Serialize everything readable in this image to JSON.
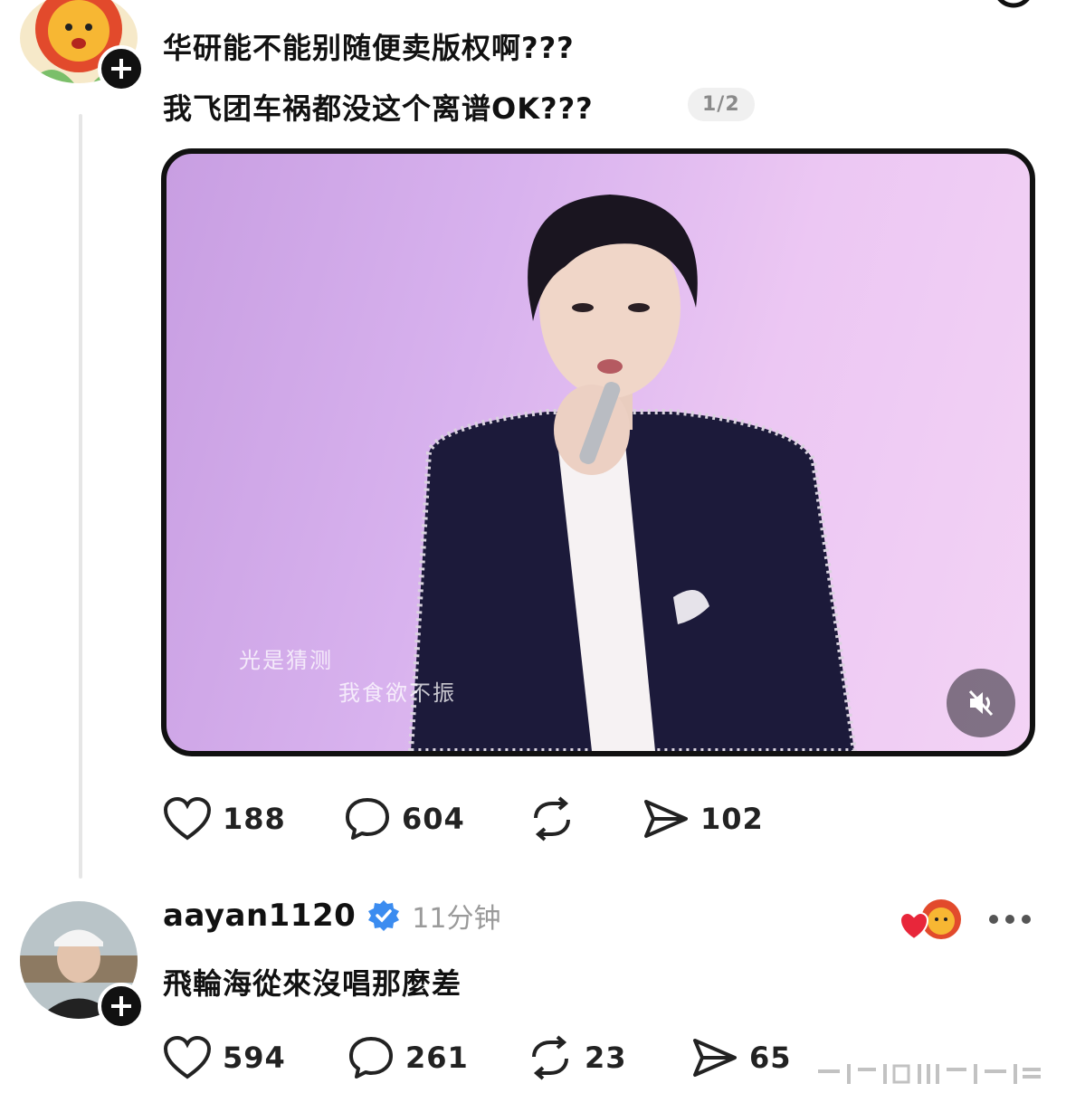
{
  "post": {
    "line1": "华研能不能别随便卖版权啊???",
    "line2": "我飞团车祸都没这个离谱OK???",
    "pager": "1/2",
    "media": {
      "lyric_line1": "光是猜测",
      "lyric_line2": "我食欲不振"
    },
    "actions": {
      "likes": "188",
      "comments": "604",
      "shares": "102"
    }
  },
  "reply": {
    "username": "aayan1120",
    "time": "11分钟",
    "text": "飛輪海從來沒唱那麼差",
    "actions": {
      "likes": "594",
      "comments": "261",
      "reposts": "23",
      "shares": "65"
    }
  },
  "colors": {
    "verified": "#3b8cf0",
    "like_heart": "#e8263a",
    "lion": "#f4a12c"
  }
}
